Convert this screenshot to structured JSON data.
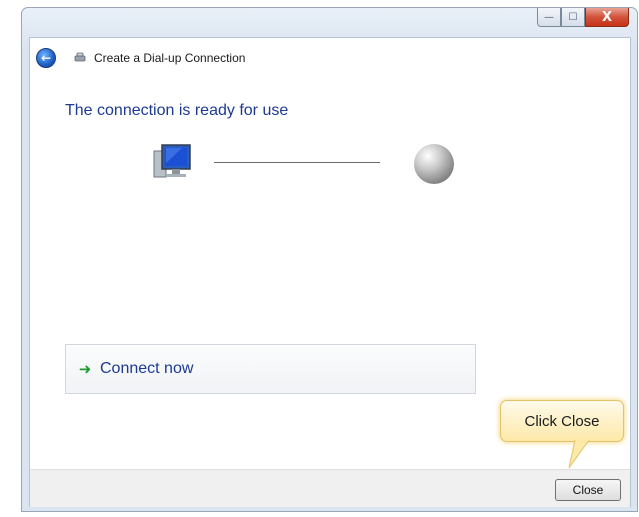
{
  "window": {
    "title": "Create a Dial-up Connection",
    "caption_buttons": {
      "minimize": "—",
      "maximize": "☐",
      "close": "X"
    }
  },
  "main": {
    "heading": "The connection is ready for use",
    "connect_action": {
      "label": "Connect now",
      "icon": "green-arrow-icon"
    },
    "illustration": {
      "left_icon": "computer-icon",
      "right_icon": "globe-icon"
    }
  },
  "callout": {
    "text": "Click Close"
  },
  "footer": {
    "close_label": "Close"
  },
  "colors": {
    "heading": "#1c3a92",
    "arrow": "#1e9d2f",
    "callout_bg": "#fde9a8"
  }
}
